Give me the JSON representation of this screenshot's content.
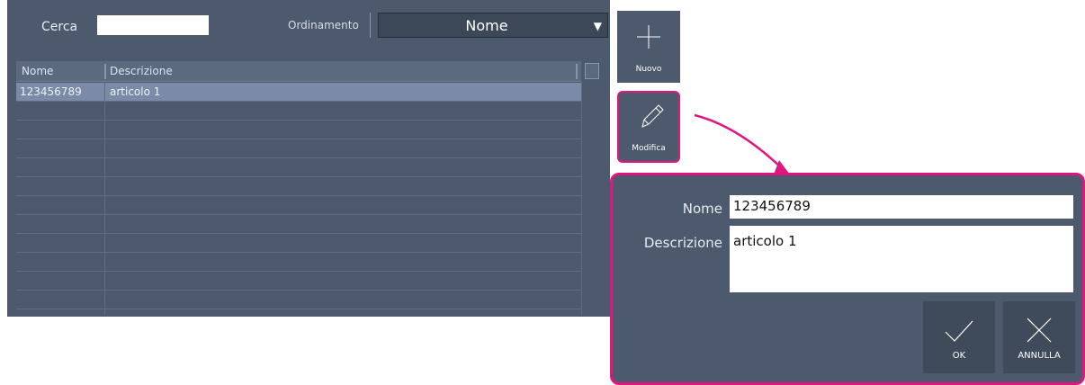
{
  "search": {
    "label": "Cerca",
    "value": ""
  },
  "sort": {
    "label": "Ordinamento",
    "value": "Nome"
  },
  "table": {
    "columns": [
      "Nome",
      "Descrizione"
    ],
    "rows": [
      {
        "nome": "123456789",
        "descrizione": "articolo 1",
        "selected": true
      }
    ]
  },
  "toolbar": {
    "new_label": "Nuovo",
    "edit_label": "Modifica"
  },
  "edit_form": {
    "nome_label": "Nome",
    "nome_value": "123456789",
    "desc_label": "Descrizione",
    "desc_value": "articolo 1",
    "ok_label": "OK",
    "cancel_label": "ANNULLA"
  },
  "colors": {
    "panel": "#4d5a6e",
    "accent": "#e0157f",
    "selected_row": "#7b8aa6"
  }
}
